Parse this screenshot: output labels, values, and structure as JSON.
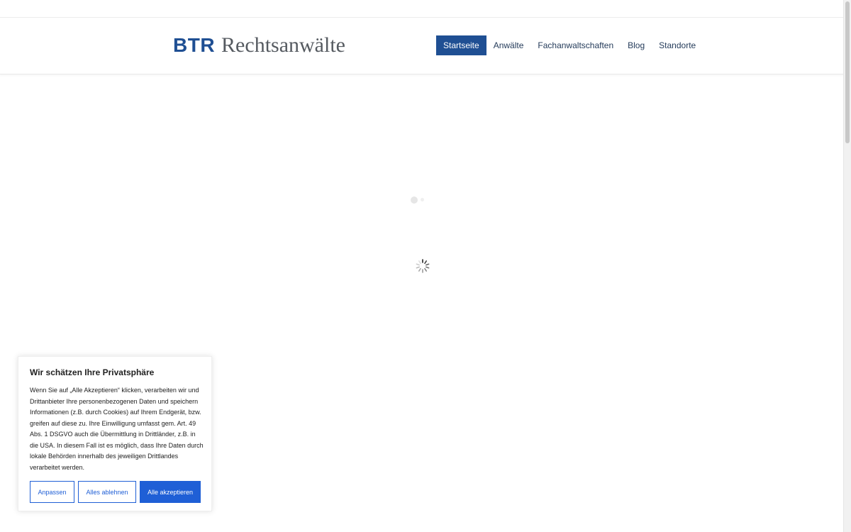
{
  "header": {
    "logo": {
      "mark": "BTR",
      "text": "Rechtsanwälte"
    },
    "nav": [
      {
        "label": "Startseite",
        "active": true
      },
      {
        "label": "Anwälte",
        "active": false
      },
      {
        "label": "Fachanwaltschaften",
        "active": false
      },
      {
        "label": "Blog",
        "active": false
      },
      {
        "label": "Standorte",
        "active": false
      }
    ]
  },
  "cookie_banner": {
    "title": "Wir schätzen Ihre Privatsphäre",
    "body": "Wenn Sie auf „Alle Akzeptieren“ klicken, verarbeiten wir und Drittanbieter Ihre personenbezogenen Daten und speichern Informationen (z.B. durch Cookies) auf Ihrem Endgerät, bzw. greifen auf diese zu. Ihre Einwilligung umfasst gem. Art. 49 Abs. 1 DSGVO auch die Übermittlung in Drittländer, z.B. in die USA. In diesem Fall ist es möglich, dass Ihre Daten durch lokale Behörden innerhalb des jeweiligen Drittlandes verarbeitet werden.",
    "buttons": {
      "customize": "Anpassen",
      "reject": "Alles ablehnen",
      "accept": "Alle akzeptieren"
    }
  },
  "icons": {
    "loader": "loading-dots-icon",
    "spinner": "spinner-icon"
  },
  "colors": {
    "brand": "#1f4f93",
    "cookie_button": "#1f5fd6"
  }
}
